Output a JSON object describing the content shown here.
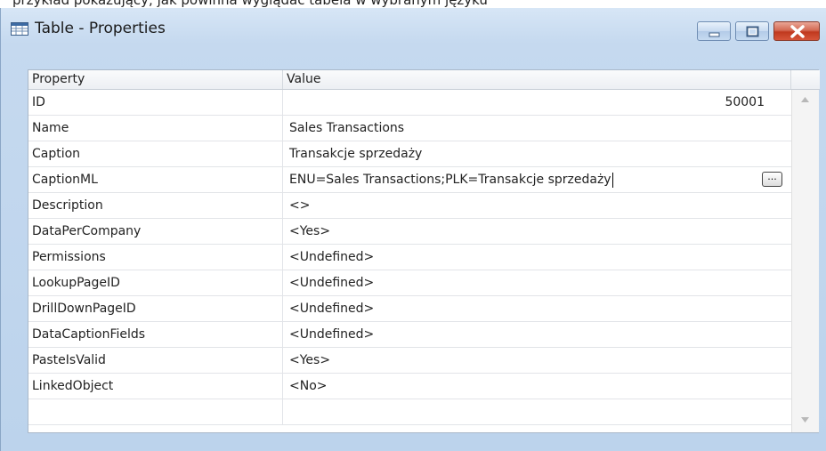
{
  "top_crop_text": "przykład pokazujący, jak powinna wyglądać tabela w wybranym języku",
  "window": {
    "title": "Table - Properties",
    "title_icon": "table-grid-icon",
    "buttons": {
      "minimize": "minimize-icon",
      "maximize": "maximize-icon",
      "close": "close-icon"
    }
  },
  "grid": {
    "columns": [
      "Property",
      "Value"
    ],
    "rows": [
      {
        "property": "ID",
        "value": "50001"
      },
      {
        "property": "Name",
        "value": "Sales Transactions"
      },
      {
        "property": "Caption",
        "value": "Transakcje sprzedaży"
      },
      {
        "property": "CaptionML",
        "value": "ENU=Sales Transactions;PLK=Transakcje sprzedaży"
      },
      {
        "property": "Description",
        "value": "<>"
      },
      {
        "property": "DataPerCompany",
        "value": "<Yes>"
      },
      {
        "property": "Permissions",
        "value": "<Undefined>"
      },
      {
        "property": "LookupPageID",
        "value": "<Undefined>"
      },
      {
        "property": "DrillDownPageID",
        "value": "<Undefined>"
      },
      {
        "property": "DataCaptionFields",
        "value": "<Undefined>"
      },
      {
        "property": "PasteIsValid",
        "value": "<Yes>"
      },
      {
        "property": "LinkedObject",
        "value": "<No>"
      },
      {
        "property": "",
        "value": ""
      }
    ],
    "assist_button_label": "..."
  },
  "colors": {
    "frame": "#c5d9ef",
    "close_button": "#c0391f"
  }
}
